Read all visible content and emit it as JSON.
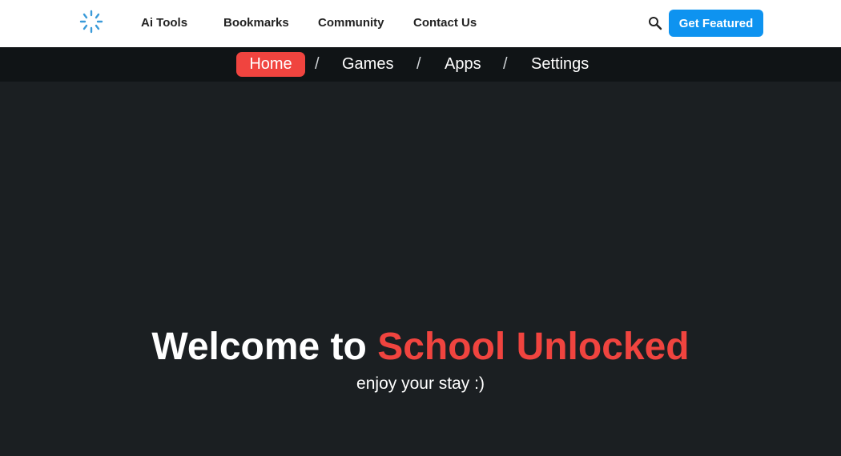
{
  "topnav": {
    "logo_icon": "spinner-logo-icon",
    "links": [
      "Ai Tools",
      "Bookmarks",
      "Community",
      "Contact Us"
    ],
    "search_icon": "search-icon",
    "cta_label": "Get Featured"
  },
  "subnav": {
    "items": [
      "Home",
      "Games",
      "Apps",
      "Settings"
    ],
    "separator": "/",
    "active": "Home"
  },
  "hero": {
    "title_prefix": "Welcome to ",
    "title_highlight": "School Unlocked",
    "subtitle": "enjoy your stay :)"
  },
  "colors": {
    "background": "#1b1f22",
    "subnav_background": "#101416",
    "accent_red": "#f0443f",
    "cta_blue": "#0e93f0",
    "logo_blue": "#3b9bd9"
  }
}
